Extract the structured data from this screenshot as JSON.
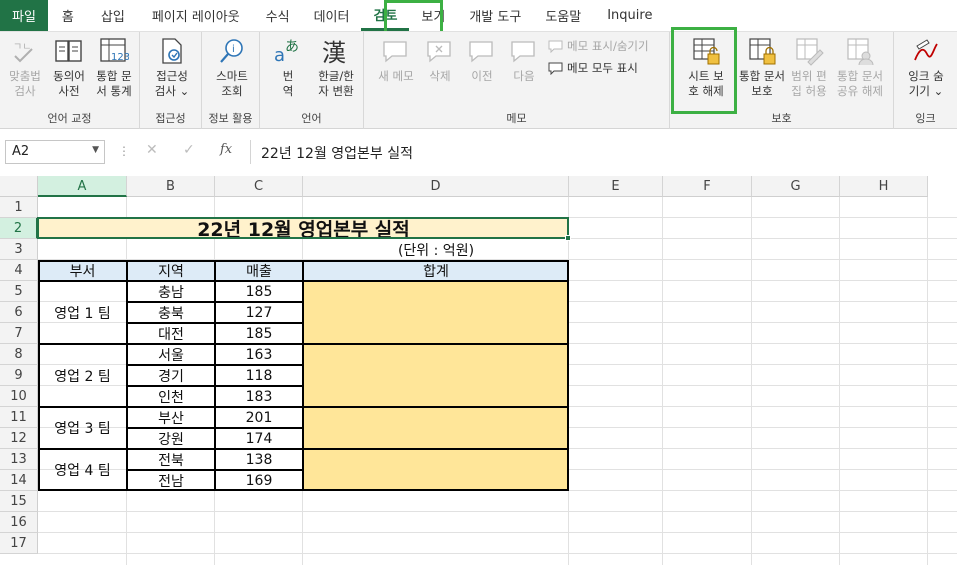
{
  "tabs": [
    "파일",
    "홈",
    "삽입",
    "페이지 레이아웃",
    "수식",
    "데이터",
    "검토",
    "보기",
    "개발 도구",
    "도움말",
    "Inquire"
  ],
  "active_tab": "검토",
  "ribbon": {
    "proofing": {
      "label": "언어 교정",
      "spell": "맞춤법\n검사",
      "thesaurus": "동의어\n사전",
      "stats": "통합 문\n서 통계"
    },
    "accessibility": {
      "label": "접근성",
      "check": "접근성\n검사 ⌄"
    },
    "insights": {
      "label": "정보 활용",
      "smart": "스마트\n조회"
    },
    "language": {
      "label": "언어",
      "translate": "번\n역",
      "hanja": "한글/한\n자 변환"
    },
    "comments": {
      "label": "메모",
      "new": "새 메모",
      "delete": "삭제",
      "prev": "이전",
      "next": "다음",
      "show_hide": "메모 표시/숨기기",
      "show_all": "메모 모두 표시"
    },
    "protect": {
      "label": "보호",
      "unprotect_sheet": "시트 보\n호 해제",
      "protect_workbook": "통합 문서\n보호",
      "allow_edit": "범위 편\n집 허용",
      "unshare": "통합 문서\n공유 해제"
    },
    "ink": {
      "label": "잉크",
      "hide_ink": "잉크 숨\n기기 ⌄"
    }
  },
  "formula_bar": {
    "name_box": "A2",
    "formula": "22년 12월 영업본부 실적",
    "fx": "fx"
  },
  "columns": [
    "A",
    "B",
    "C",
    "D",
    "E",
    "F",
    "G",
    "H"
  ],
  "rows": [
    "1",
    "2",
    "3",
    "4",
    "5",
    "6",
    "7",
    "8",
    "9",
    "10",
    "11",
    "12",
    "13",
    "14",
    "15",
    "16",
    "17"
  ],
  "sheet": {
    "title": "22년 12월 영업본부 실적",
    "unit": "(단위 : 억원)",
    "headers": [
      "부서",
      "지역",
      "매출",
      "합계"
    ],
    "teams": [
      {
        "name": "영업 1 팀",
        "regions": [
          {
            "region": "충남",
            "sales": "185"
          },
          {
            "region": "충북",
            "sales": "127"
          },
          {
            "region": "대전",
            "sales": "185"
          }
        ]
      },
      {
        "name": "영업 2 팀",
        "regions": [
          {
            "region": "서울",
            "sales": "163"
          },
          {
            "region": "경기",
            "sales": "118"
          },
          {
            "region": "인천",
            "sales": "183"
          }
        ]
      },
      {
        "name": "영업 3 팀",
        "regions": [
          {
            "region": "부산",
            "sales": "201"
          },
          {
            "region": "강원",
            "sales": "174"
          }
        ]
      },
      {
        "name": "영업 4 팀",
        "regions": [
          {
            "region": "전북",
            "sales": "138"
          },
          {
            "region": "전남",
            "sales": "169"
          }
        ]
      }
    ]
  }
}
